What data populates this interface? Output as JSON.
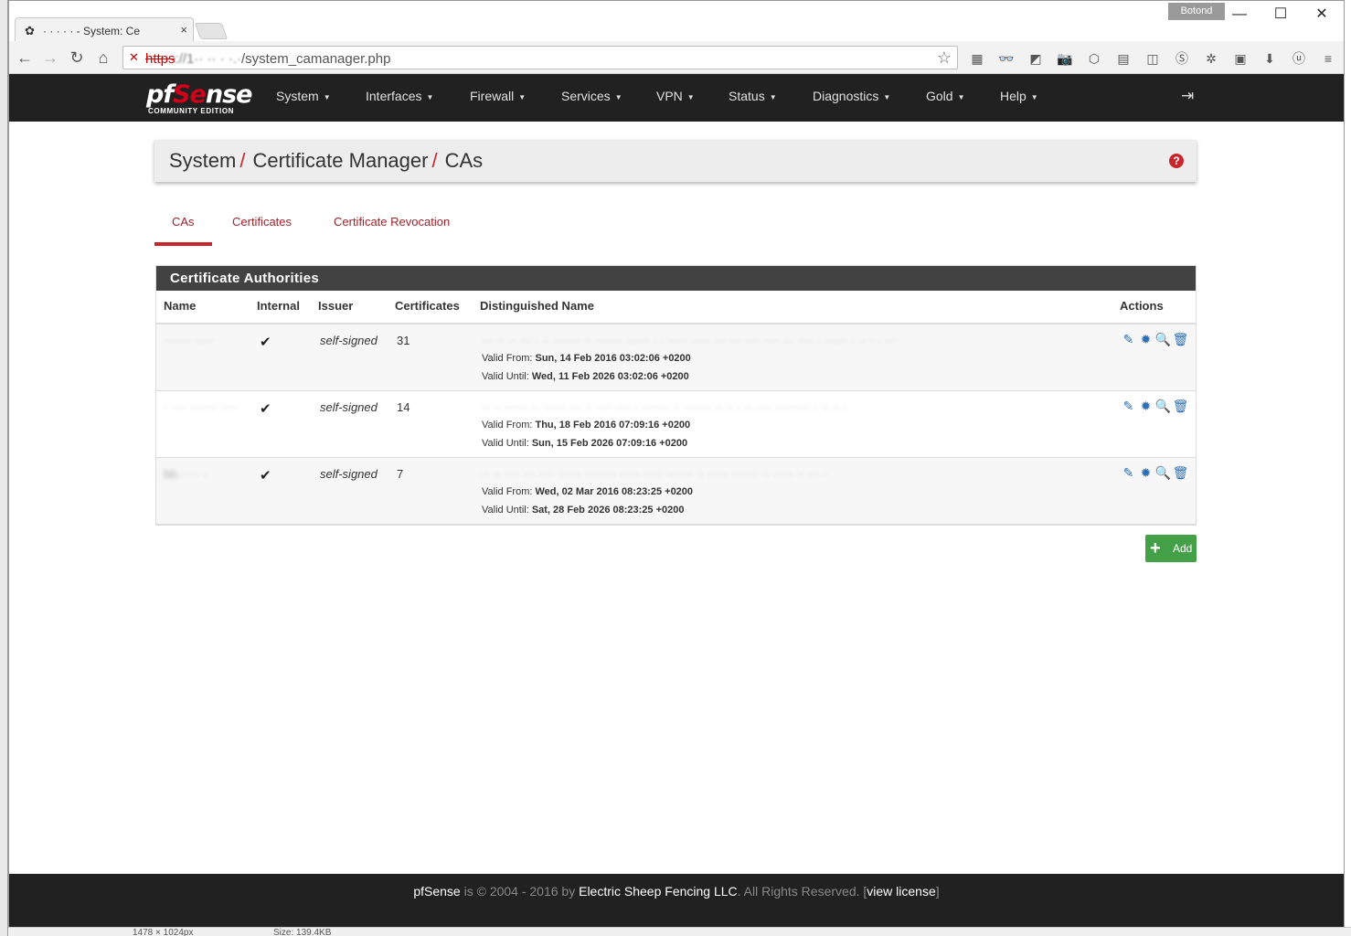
{
  "browser": {
    "tab_title": "· · · · ·  - System: Ce",
    "tab_close": "×",
    "user_badge": "Botond",
    "url_proto": "https",
    "url_host": "://1·· ·· · ·.·",
    "url_path": "/system_camanager.php",
    "window_controls": {
      "min": "—",
      "max": "☐",
      "close": "✕"
    },
    "nav": {
      "back": "←",
      "forward": "→",
      "reload": "↻",
      "home": "⌂"
    },
    "extensions": [
      "▦",
      "👓",
      "◩",
      "📷",
      "⬡",
      "▤",
      "◫",
      "Ⓢ",
      "✲",
      "▣",
      "⬇",
      "ⓤ",
      "≡"
    ]
  },
  "navbar": {
    "brand_pf": "pf",
    "brand_se": "Se",
    "brand_nse": "nse",
    "edition": "COMMUNITY EDITION",
    "menu": [
      "System",
      "Interfaces",
      "Firewall",
      "Services",
      "VPN",
      "Status",
      "Diagnostics",
      "Gold",
      "Help"
    ]
  },
  "breadcrumb": {
    "items": [
      "System",
      "Certificate Manager",
      "CAs"
    ],
    "separator": "/",
    "help_icon": "?"
  },
  "tabs": [
    "CAs",
    "Certificates",
    "Certificate Revocation"
  ],
  "panel": {
    "title": "Certificate Authorities",
    "columns": [
      "Name",
      "Internal",
      "Issuer",
      "Certificates",
      "Distinguished Name",
      "Actions"
    ],
    "rows": [
      {
        "name": "·······  ·····",
        "internal": "✔",
        "issuer": "self-signed",
        "certificates": "31",
        "dn": "··· ·· ·· ··· · ·· ······· ·· ······· ······ · · ····· ····· ··· ··· ···· ···· ··· ···· · ······ · ·· · · ···",
        "valid_from_label": "Valid From:",
        "valid_from": "Sun, 14 Feb 2016 03:02:06 +0200",
        "valid_until_label": "Valid Until:",
        "valid_until": "Wed, 11 Feb 2026 03:02:06 +0200"
      },
      {
        "name": "· ···· ······· ····",
        "internal": "✔",
        "issuer": "self-signed",
        "certificates": "14",
        "dn": "·· ·· ······ ·· ······ ··· ·· ···· ···· · ······· ·· ······· ·· ·· · ·· ···· ········· · ·· ·· ·",
        "valid_from_label": "Valid From:",
        "valid_from": "Thu, 18 Feb 2016 07:09:16 +0200",
        "valid_until_label": "Valid Until:",
        "valid_until": "Sun, 15 Feb 2026 07:09:16 +0200"
      },
      {
        "name": "bb.·····  ·",
        "internal": "✔",
        "issuer": "self-signed",
        "certificates": "7",
        "dn": "·· ·· ···· ··· ···· ······ ········ ····· ····· ······· ·· ····· ······· ·· ····· ·· ··· ·",
        "valid_from_label": "Valid From:",
        "valid_from": "Wed, 02 Mar 2016 08:23:25 +0200",
        "valid_until_label": "Valid Until:",
        "valid_until": "Sat, 28 Feb 2026 08:23:25 +0200"
      }
    ],
    "action_icons": {
      "edit": "✎",
      "export": "✹",
      "key": "🔍",
      "delete": "🗑"
    }
  },
  "add_button": {
    "icon": "+",
    "label": "Add"
  },
  "footer": {
    "brand": "pfSense",
    "text1": " is © 2004 - 2016 by ",
    "company": "Electric Sheep Fencing LLC",
    "text2": ". All Rights Reserved. [",
    "license": "view license",
    "text3": "]"
  },
  "status_strip": {
    "dims": "1478 × 1024px",
    "size": "Size: 139.4KB"
  }
}
